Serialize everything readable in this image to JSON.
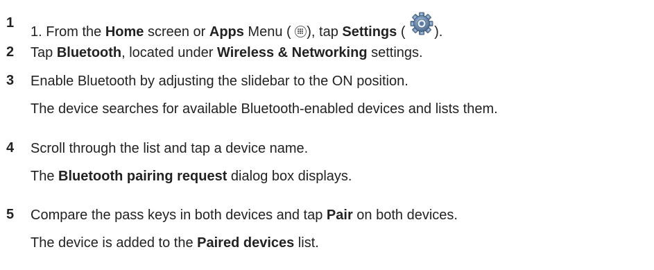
{
  "steps": [
    {
      "number": "1",
      "line1": {
        "prefix": "1. From the ",
        "home": "Home",
        "mid1": " screen or ",
        "apps": "Apps",
        "mid2": " Menu ( ",
        "mid3": "), tap ",
        "settings": "Settings",
        "mid4": " ( ",
        "end": ")."
      }
    },
    {
      "number": "2",
      "line1": {
        "prefix": "Tap ",
        "bluetooth": "Bluetooth",
        "mid": ", located under ",
        "wireless": "Wireless & Networking",
        "end": " settings."
      }
    },
    {
      "number": "3",
      "line1": "Enable Bluetooth by adjusting the slidebar to the ON position.",
      "line2": "The device searches for available Bluetooth-enabled devices and lists them."
    },
    {
      "number": "4",
      "line1": "Scroll through the list and tap a device name.",
      "line2": {
        "prefix": "The ",
        "dialog": "Bluetooth pairing request",
        "end": " dialog box displays."
      }
    },
    {
      "number": "5",
      "line1": {
        "prefix": "Compare the pass keys in both devices and tap ",
        "pair": "Pair",
        "end": " on both devices."
      },
      "line2": {
        "prefix": "The device is added to the ",
        "paired": "Paired devices",
        "end": " list."
      }
    }
  ],
  "icons": {
    "apps": "apps-menu-icon",
    "settings": "settings-gear-icon",
    "gear_color": "#5a7fa8"
  }
}
